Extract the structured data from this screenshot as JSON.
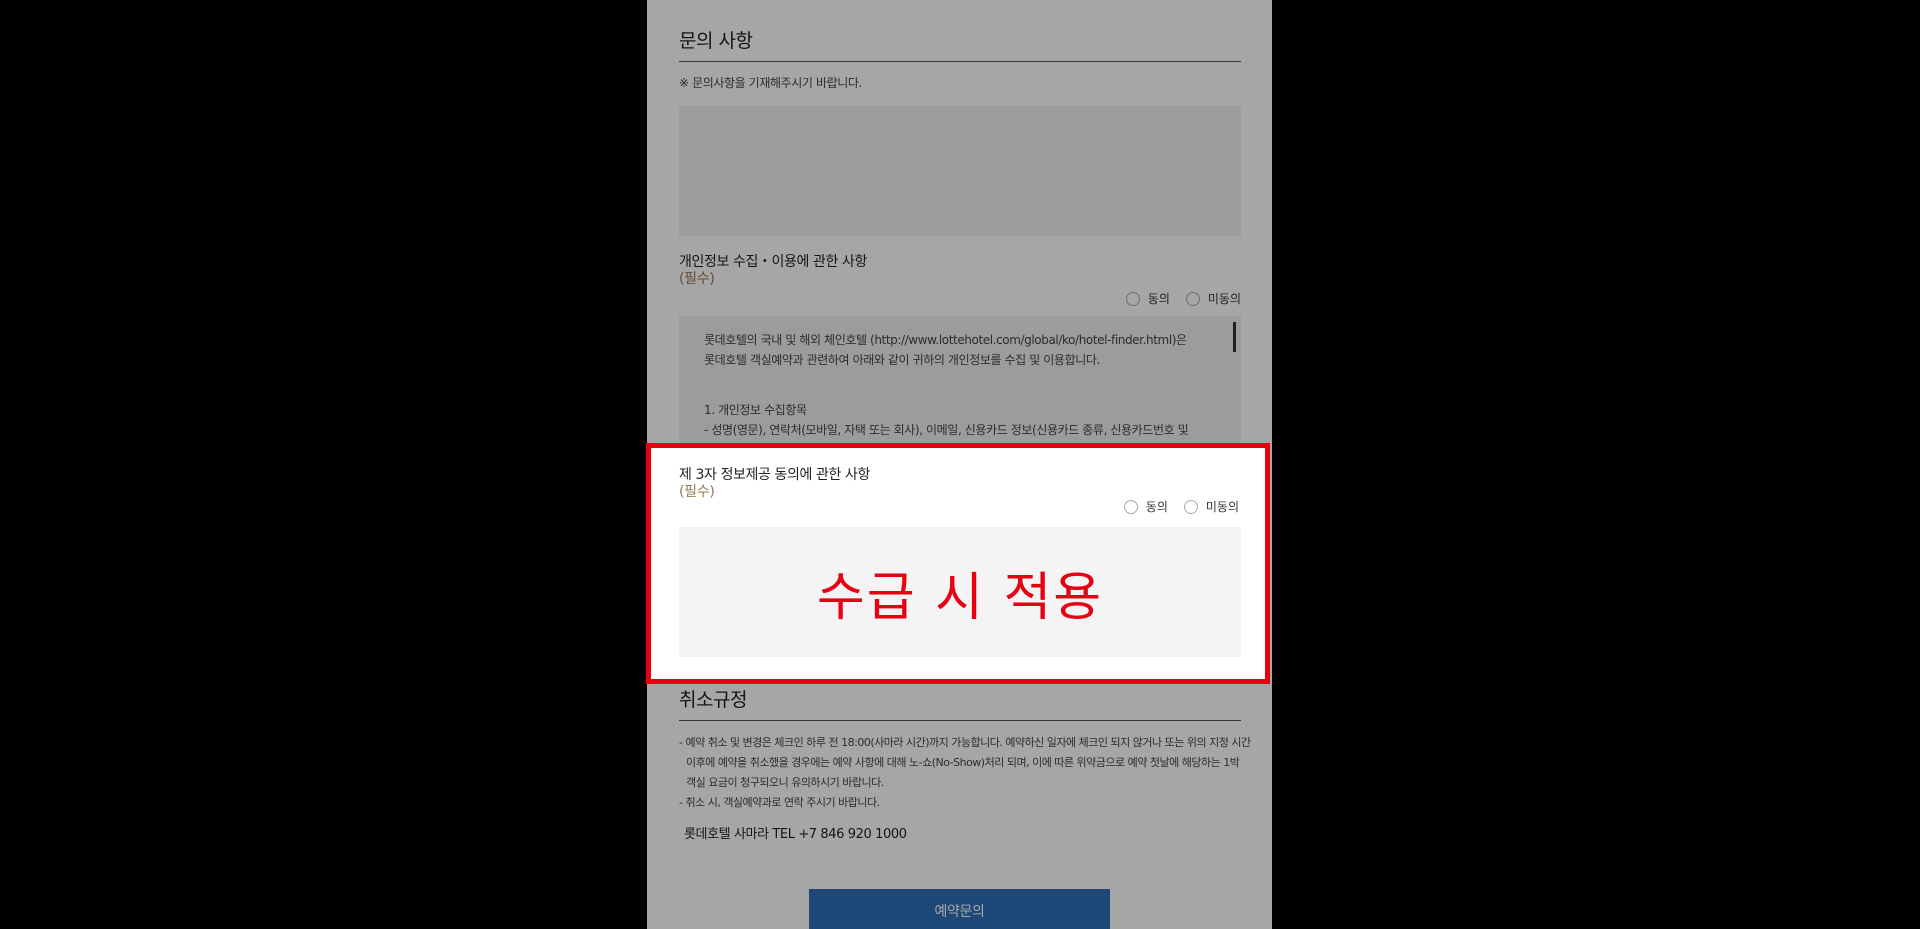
{
  "inquiry": {
    "title": "문의 사항",
    "note": "※ 문의사항을 기재해주시기 바랍니다.",
    "textarea_value": ""
  },
  "privacy": {
    "label": "개인정보 수집・이용에 관한 사항",
    "required": "(필수)",
    "agree": "동의",
    "disagree": "미동의",
    "content": {
      "p1_line1": "롯데호텔의 국내 및 해외 체인호텔 (http://www.lottehotel.com/global/ko/hotel-finder.html)은",
      "p1_line2": "롯데호텔 객실예약과 관련하여 아래와 같이 귀하의 개인정보를 수집 및 이용합니다.",
      "item1_title": "1. 개인정보 수집항목",
      "item1_line1": "- 성명(영문), 연락처(모바일, 자택 또는 회사), 이메일, 신용카드 정보(신용카드 종류, 신용카드번호 및"
    }
  },
  "third_party": {
    "label": "제 3자 정보제공 동의에 관한 사항",
    "required": "(필수)",
    "agree": "동의",
    "disagree": "미동의",
    "overlay_text": "수급 시 적용"
  },
  "cancellation": {
    "title": "취소규정",
    "lines": [
      "- 예약 취소 및 변경은 체크인 하루 전 18:00(사마라 시간)까지 가능합니다. 예약하신 일자에 체크인 되지 않거나 또는 위의 지정 시간",
      "이후에 예약을 취소했을 경우에는 예약 사항에 대해 노-쇼(No-Show)처리 되며, 이에 따른 위약금으로 예약 첫날에 해당하는 1박",
      "객실 요금이 청구되오니 유의하시기 바랍니다.",
      "- 취소 시, 객실예약과로 연락 주시기 바랍니다."
    ],
    "contact": "롯데호텔 사마라 TEL +7 846 920 1000"
  },
  "reserve_button": "예약문의",
  "colors": {
    "highlight_border": "#e60012",
    "required_text": "#9a7a52",
    "button": "#2d6fb8"
  }
}
